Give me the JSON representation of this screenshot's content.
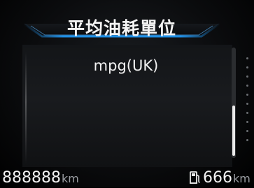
{
  "header": {
    "title": "平均油耗單位"
  },
  "setting": {
    "value": "mpg(UK)"
  },
  "footer": {
    "odometer_value": "888888",
    "odometer_unit": "km",
    "range_value": "666",
    "range_unit": "km"
  },
  "icons": {
    "fuel": "fuel-pump-icon"
  },
  "scroll": {
    "position_fraction": 0.55
  },
  "colors": {
    "accent": "#1e8fe6",
    "background": "#000000",
    "text": "#ffffff"
  }
}
